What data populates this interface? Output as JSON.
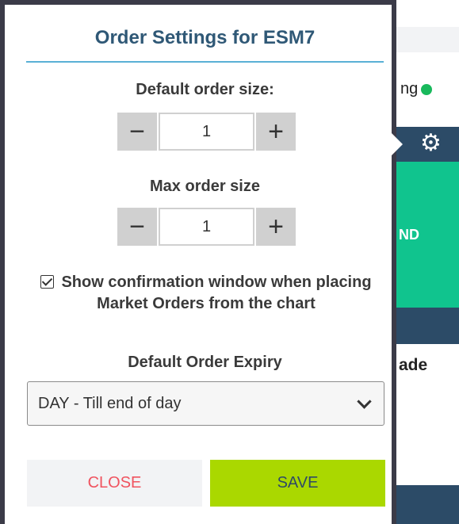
{
  "background": {
    "status_text": "ng",
    "status_color": "#19b95c",
    "panel_label": "ND",
    "panel_color": "#10c48e",
    "lower_label": "ade",
    "bar_color": "#2c4b67",
    "gear_icon": "⚙"
  },
  "dialog": {
    "title": "Order Settings for ESM7",
    "default_size": {
      "label": "Default order size:",
      "value": "1",
      "minus": "−",
      "plus": "+"
    },
    "max_size": {
      "label": "Max order size",
      "value": "1",
      "minus": "−",
      "plus": "+"
    },
    "confirm": {
      "checked": true,
      "label": "Show confirmation window when placing Market Orders from the chart"
    },
    "expiry": {
      "label": "Default Order Expiry",
      "selected": "DAY - Till end of day"
    },
    "buttons": {
      "close": "CLOSE",
      "save": "SAVE"
    },
    "colors": {
      "title": "#2f5876",
      "underline": "#5ab0d6",
      "close_text": "#f0535f",
      "save_bg": "#aad800"
    }
  }
}
